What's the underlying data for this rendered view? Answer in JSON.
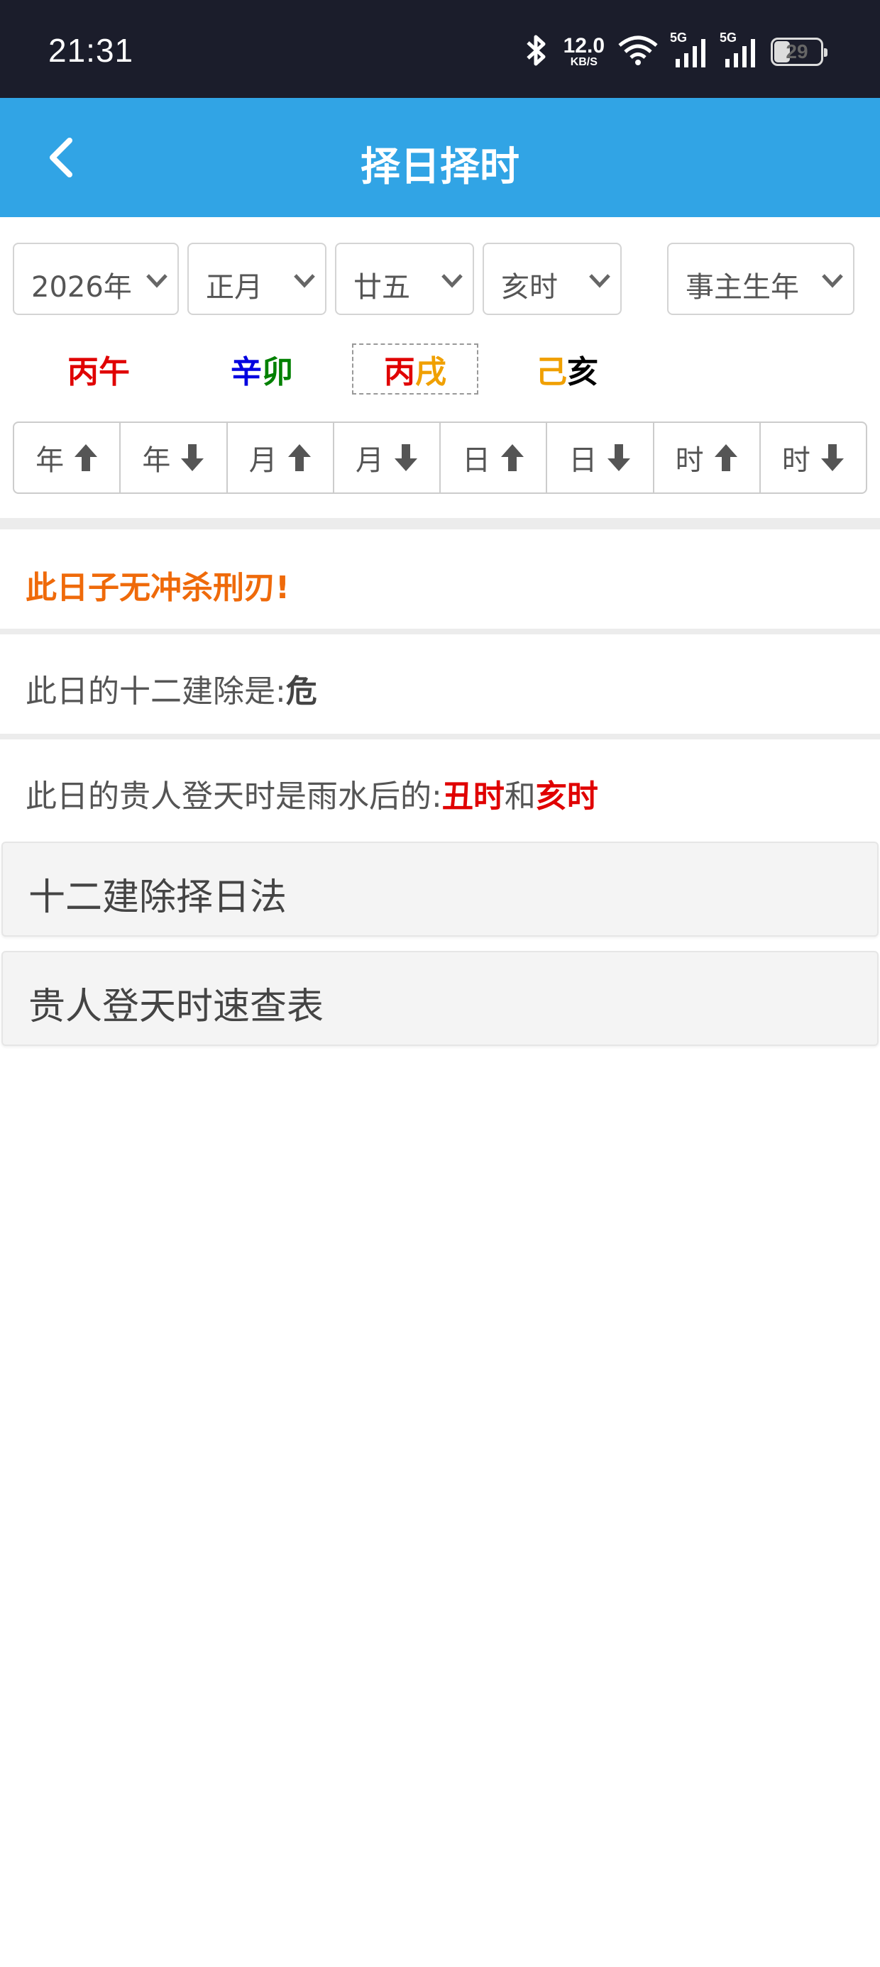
{
  "status_bar": {
    "time": "21:31",
    "speed_value": "12.0",
    "speed_unit": "KB/S",
    "net1": "5G",
    "net2": "5G",
    "battery": "29",
    "icons": [
      "bluetooth-icon",
      "wifi-icon",
      "signal-icon",
      "signal-icon",
      "battery-icon"
    ]
  },
  "header": {
    "title": "择日择时",
    "back_icon": "chevron-left-icon",
    "background": "#31a4e5"
  },
  "selects": {
    "year": "2026年",
    "month": "正月",
    "day": "廿五",
    "hour": "亥时",
    "owner": "事主生年"
  },
  "ganzhi": [
    {
      "stem": "丙",
      "branch": "午",
      "stem_color": "#e00000",
      "branch_color": "#e00000",
      "selected": false
    },
    {
      "stem": "辛",
      "branch": "卯",
      "stem_color": "#0000e0",
      "branch_color": "#008000",
      "selected": false
    },
    {
      "stem": "丙",
      "branch": "戌",
      "stem_color": "#e00000",
      "branch_color": "#f0a000",
      "selected": true
    },
    {
      "stem": "己",
      "branch": "亥",
      "stem_color": "#f0a000",
      "branch_color": "#000000",
      "selected": false
    }
  ],
  "sort_buttons": [
    {
      "label": "年",
      "dir": "up"
    },
    {
      "label": "年",
      "dir": "down"
    },
    {
      "label": "月",
      "dir": "up"
    },
    {
      "label": "月",
      "dir": "down"
    },
    {
      "label": "日",
      "dir": "up"
    },
    {
      "label": "日",
      "dir": "down"
    },
    {
      "label": "时",
      "dir": "up"
    },
    {
      "label": "时",
      "dir": "down"
    }
  ],
  "info": {
    "warning": "此日子无冲杀刑刃!",
    "jianchu_prefix": "此日的十二建除是:",
    "jianchu_value": "危",
    "guiren_prefix": "此日的贵人登天时是雨水后的:",
    "guiren_time1": "丑时",
    "guiren_and": "和",
    "guiren_time2": "亥时"
  },
  "panels": {
    "jianchu_method": "十二建除择日法",
    "guiren_table": "贵人登天时速查表"
  }
}
